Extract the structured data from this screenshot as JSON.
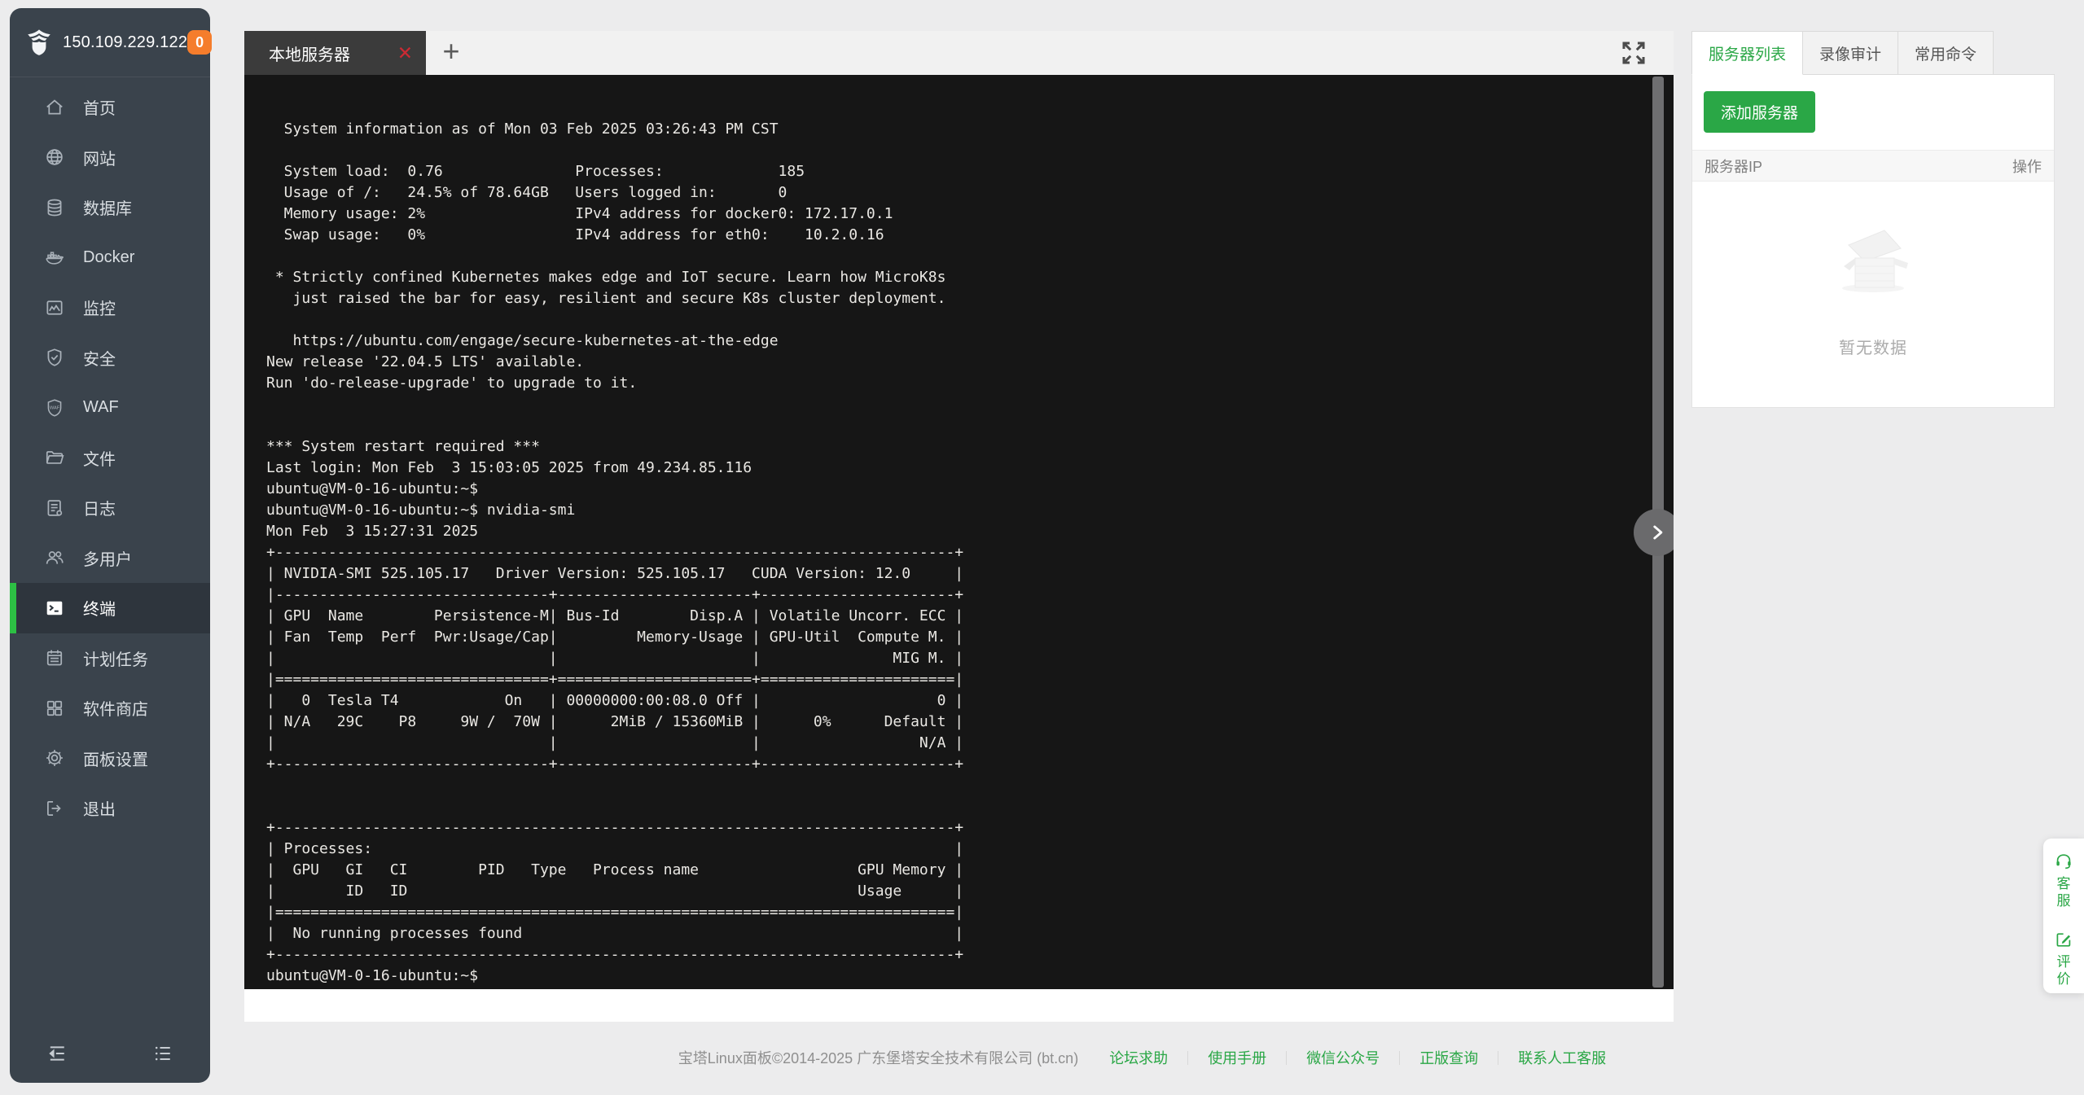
{
  "sidebar": {
    "ip": "150.109.229.122",
    "badge_count": "0",
    "items": [
      {
        "label": "首页",
        "icon": "home-icon"
      },
      {
        "label": "网站",
        "icon": "globe-icon"
      },
      {
        "label": "数据库",
        "icon": "database-icon"
      },
      {
        "label": "Docker",
        "icon": "docker-icon"
      },
      {
        "label": "监控",
        "icon": "monitor-icon"
      },
      {
        "label": "安全",
        "icon": "shield-check-icon"
      },
      {
        "label": "WAF",
        "icon": "waf-shield-icon"
      },
      {
        "label": "文件",
        "icon": "folder-icon"
      },
      {
        "label": "日志",
        "icon": "log-file-icon"
      },
      {
        "label": "多用户",
        "icon": "users-icon"
      },
      {
        "label": "终端",
        "icon": "terminal-icon",
        "active": true
      },
      {
        "label": "计划任务",
        "icon": "calendar-icon"
      },
      {
        "label": "软件商店",
        "icon": "appstore-icon"
      },
      {
        "label": "面板设置",
        "icon": "gear-icon"
      },
      {
        "label": "退出",
        "icon": "logout-icon"
      }
    ]
  },
  "terminal": {
    "tab_title": "本地服务器",
    "add_tab_label": "+",
    "close_label": "✕",
    "lines": [
      "",
      "  System information as of Mon 03 Feb 2025 03:26:43 PM CST",
      "",
      "  System load:  0.76               Processes:             185",
      "  Usage of /:   24.5% of 78.64GB   Users logged in:       0",
      "  Memory usage: 2%                 IPv4 address for docker0: 172.17.0.1",
      "  Swap usage:   0%                 IPv4 address for eth0:    10.2.0.16",
      "",
      " * Strictly confined Kubernetes makes edge and IoT secure. Learn how MicroK8s",
      "   just raised the bar for easy, resilient and secure K8s cluster deployment.",
      "",
      "   https://ubuntu.com/engage/secure-kubernetes-at-the-edge",
      "New release '22.04.5 LTS' available.",
      "Run 'do-release-upgrade' to upgrade to it.",
      "",
      "",
      "*** System restart required ***",
      "Last login: Mon Feb  3 15:03:05 2025 from 49.234.85.116",
      "ubuntu@VM-0-16-ubuntu:~$",
      "ubuntu@VM-0-16-ubuntu:~$ nvidia-smi",
      "Mon Feb  3 15:27:31 2025",
      "+-----------------------------------------------------------------------------+",
      "| NVIDIA-SMI 525.105.17   Driver Version: 525.105.17   CUDA Version: 12.0     |",
      "|-------------------------------+----------------------+----------------------+",
      "| GPU  Name        Persistence-M| Bus-Id        Disp.A | Volatile Uncorr. ECC |",
      "| Fan  Temp  Perf  Pwr:Usage/Cap|         Memory-Usage | GPU-Util  Compute M. |",
      "|                               |                      |               MIG M. |",
      "|===============================+======================+======================|",
      "|   0  Tesla T4            On   | 00000000:00:08.0 Off |                    0 |",
      "| N/A   29C    P8     9W /  70W |      2MiB / 15360MiB |      0%      Default |",
      "|                               |                      |                  N/A |",
      "+-------------------------------+----------------------+----------------------+",
      "",
      "",
      "+-----------------------------------------------------------------------------+",
      "| Processes:                                                                  |",
      "|  GPU   GI   CI        PID   Type   Process name                  GPU Memory |",
      "|        ID   ID                                                   Usage      |",
      "|=============================================================================|",
      "|  No running processes found                                                 |",
      "+-----------------------------------------------------------------------------+",
      "ubuntu@VM-0-16-ubuntu:~$ "
    ]
  },
  "server_panel": {
    "tabs": [
      {
        "label": "服务器列表",
        "active": true
      },
      {
        "label": "录像审计"
      },
      {
        "label": "常用命令"
      }
    ],
    "add_button_label": "添加服务器",
    "table_headers": {
      "ip": "服务器IP",
      "action": "操作"
    },
    "empty_text": "暂无数据"
  },
  "footer": {
    "copyright": "宝塔Linux面板©2014-2025 广东堡塔安全技术有限公司 (bt.cn)",
    "links": [
      "论坛求助",
      "使用手册",
      "微信公众号",
      "正版查询",
      "联系人工客服"
    ]
  },
  "floating_widget": {
    "service_label": "客服",
    "feedback_label": "评价"
  },
  "colors": {
    "accent_green": "#2aa746",
    "active_bar_green": "#2dc044",
    "badge_orange": "#f57d2c",
    "close_red": "#cb2a33",
    "sidebar_bg": "#3a434c",
    "terminal_bg": "#161616"
  }
}
